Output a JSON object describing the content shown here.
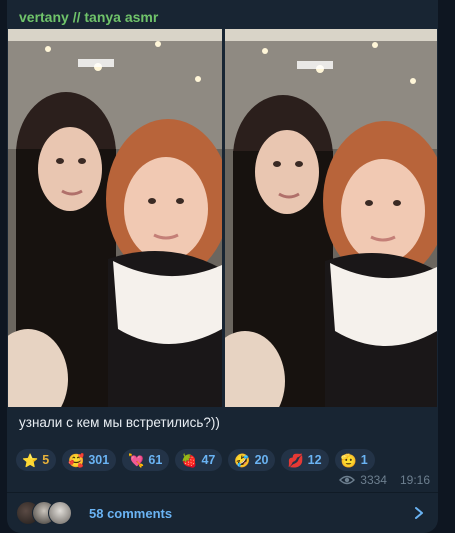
{
  "post": {
    "channel_name": "vertany // tanya asmr",
    "caption": "узнали с кем мы встретились?))",
    "views": "3334",
    "time": "19:16"
  },
  "reactions": [
    {
      "emoji": "⭐",
      "icon": "star-icon",
      "count": "5",
      "gold": true
    },
    {
      "emoji": "🥰",
      "icon": "smiling-face-with-hearts-icon",
      "count": "301"
    },
    {
      "emoji": "💘",
      "icon": "heart-with-arrow-icon",
      "count": "61"
    },
    {
      "emoji": "🍓",
      "icon": "strawberry-icon",
      "count": "47"
    },
    {
      "emoji": "🤣",
      "icon": "rolling-laughing-icon",
      "count": "20"
    },
    {
      "emoji": "💋",
      "icon": "kiss-mark-icon",
      "count": "12"
    },
    {
      "emoji": "🫡",
      "icon": "saluting-face-icon",
      "count": "1"
    }
  ],
  "comments": {
    "label": "58 comments"
  },
  "colors": {
    "background": "#0e1621",
    "bubble": "#182533",
    "channel_name": "#6fc36a",
    "link": "#6ab3f3",
    "meta": "#6d7f8f"
  }
}
